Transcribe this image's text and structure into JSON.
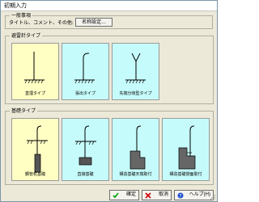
{
  "window": {
    "title": "初期入力"
  },
  "general": {
    "group_label": "一般事項",
    "description": "タイトル、コメント、その他:",
    "name_button": "名称設定..."
  },
  "lightning_rod": {
    "group_label": "避雷針タイプ",
    "items": [
      {
        "label": "直埋タイプ",
        "selected": true
      },
      {
        "label": "張出タイプ",
        "selected": false
      },
      {
        "label": "先端分岐型タイプ",
        "selected": false
      }
    ]
  },
  "foundation": {
    "group_label": "基礎タイプ",
    "items": [
      {
        "label": "鋼管杭基礎",
        "selected": true
      },
      {
        "label": "直接基礎",
        "selected": false
      },
      {
        "label": "構造基礎天端取付",
        "selected": false
      },
      {
        "label": "構造基礎側面取付",
        "selected": false
      }
    ]
  },
  "footer": {
    "ok_label": "確定",
    "cancel_label": "取消",
    "help_label": "ヘルプ(H)"
  },
  "colors": {
    "selected_bg": "#ffffc4",
    "normal_bg": "#c6fbfb",
    "ok_icon": "#00a000",
    "cancel_icon": "#d00000",
    "help_icon": "#2050d0"
  }
}
